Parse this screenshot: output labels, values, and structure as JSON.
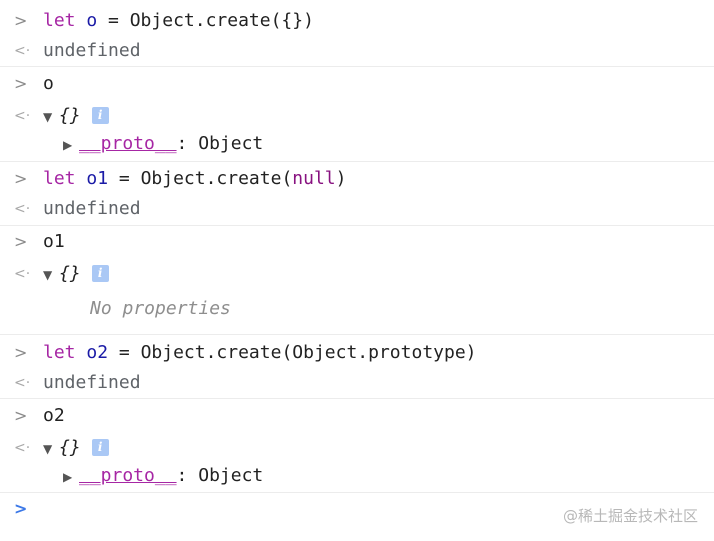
{
  "console": {
    "input_glyph": ">",
    "result_glyph": "<·",
    "expand_glyph": "▼",
    "collapse_glyph": "▶",
    "info_label": "i",
    "entries": {
      "e1": {
        "let": "let",
        "var": "o",
        "eq": " = ",
        "call": "Object.create({})"
      },
      "r1": "undefined",
      "e2": "o",
      "r2": {
        "brace": "{}",
        "proto_key": "__proto__",
        "proto_sep": ": ",
        "proto_val": "Object"
      },
      "e3": {
        "let": "let",
        "var": "o1",
        "eq": " = ",
        "call_pre": "Object.create(",
        "null": "null",
        "call_post": ")"
      },
      "r3": "undefined",
      "e4": "o1",
      "r4": {
        "brace": "{}",
        "empty": "No properties"
      },
      "e5": {
        "let": "let",
        "var": "o2",
        "eq": " = ",
        "call": "Object.create(Object.prototype)"
      },
      "r5": "undefined",
      "e6": "o2",
      "r6": {
        "brace": "{}",
        "proto_key": "__proto__",
        "proto_sep": ": ",
        "proto_val": "Object"
      }
    },
    "prompt_glyph": ">"
  },
  "watermark": "@稀土掘金技术社区"
}
